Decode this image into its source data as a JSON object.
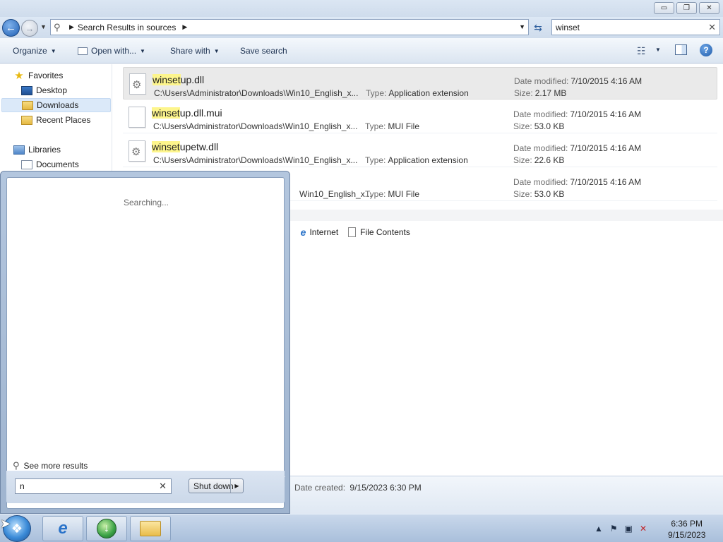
{
  "window": {
    "min": "▭",
    "max": "❐",
    "close": "✕"
  },
  "address": {
    "path": "Search Results in sources",
    "search_value": "winset"
  },
  "toolbar": {
    "organize": "Organize",
    "open_with": "Open with...",
    "share_with": "Share with",
    "save_search": "Save search"
  },
  "nav": {
    "favorites": "Favorites",
    "desktop": "Desktop",
    "downloads": "Downloads",
    "recent": "Recent Places",
    "libraries": "Libraries",
    "documents": "Documents"
  },
  "labels": {
    "date_modified": "Date modified:",
    "size": "Size:",
    "type": "Type:",
    "date_created": "Date created:"
  },
  "results": [
    {
      "hl": "winset",
      "rest": "up.dll",
      "path": "C:\\Users\\Administrator\\Downloads\\Win10_English_x...",
      "type": "Application extension",
      "date": "7/10/2015 4:16 AM",
      "size": "2.17 MB",
      "icon": "dll-gear-icon"
    },
    {
      "hl": "winset",
      "rest": "up.dll.mui",
      "path": "C:\\Users\\Administrator\\Downloads\\Win10_English_x...",
      "type": "MUI File",
      "date": "7/10/2015 4:16 AM",
      "size": "53.0 KB",
      "icon": "blank-file-icon"
    },
    {
      "hl": "winset",
      "rest": "upetw.dll",
      "path": "C:\\Users\\Administrator\\Downloads\\Win10_English_x...",
      "type": "Application extension",
      "date": "7/10/2015 4:16 AM",
      "size": "22.6 KB",
      "icon": "dll-gear-icon"
    },
    {
      "path": "Win10_English_x...",
      "type": "MUI File",
      "date": "7/10/2015 4:16 AM",
      "size": "53.0 KB"
    }
  ],
  "search_again": {
    "ellipsis": "..",
    "internet": "Internet",
    "file_contents": "File Contents"
  },
  "details": {
    "date_created": "9/15/2023 6:30 PM"
  },
  "startmenu": {
    "searching": "Searching...",
    "see_more": "See more results",
    "search_value": "n",
    "shutdown": "Shut down"
  },
  "clock": {
    "time": "6:36 PM",
    "date": "9/15/2023"
  },
  "colors": {
    "highlight": "#fdf58c",
    "selection": "#eaeaea",
    "accent": "#1f5fb4"
  }
}
